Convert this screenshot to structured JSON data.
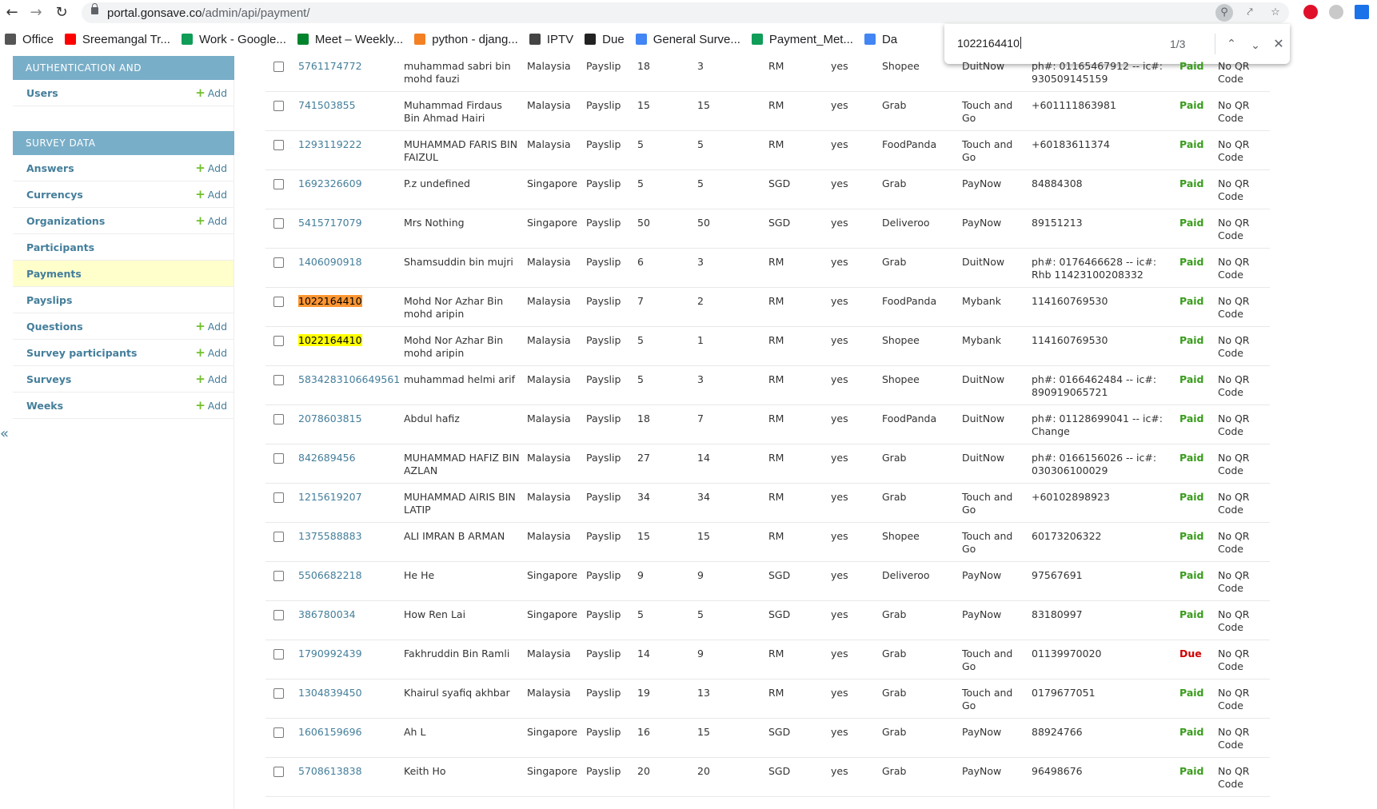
{
  "browser": {
    "url_host": "portal.gonsave.co",
    "url_path": "/admin/api/payment/",
    "bookmarks": [
      {
        "label": "Office",
        "color": "#555555"
      },
      {
        "label": "Sreemangal Tr...",
        "color": "#ff0000"
      },
      {
        "label": "Work - Google...",
        "color": "#0f9d58"
      },
      {
        "label": "Meet – Weekly...",
        "color": "#00832d"
      },
      {
        "label": "python - djang...",
        "color": "#f48024"
      },
      {
        "label": "IPTV",
        "color": "#444444"
      },
      {
        "label": "Due",
        "color": "#222222"
      },
      {
        "label": "General Surve...",
        "color": "#4285f4"
      },
      {
        "label": "Payment_Met...",
        "color": "#0f9d58"
      },
      {
        "label": "Da",
        "color": "#4285f4"
      }
    ]
  },
  "find": {
    "query": "1022164410",
    "count": "1/3"
  },
  "sidebar": {
    "auth": {
      "caption": "AUTHENTICATION AND AUTHORIZATION",
      "items": [
        {
          "label": "Users",
          "add": "Add"
        }
      ]
    },
    "survey": {
      "caption": "SURVEY DATA",
      "items": [
        {
          "label": "Answers",
          "add": "Add"
        },
        {
          "label": "Currencys",
          "add": "Add"
        },
        {
          "label": "Organizations",
          "add": "Add"
        },
        {
          "label": "Participants",
          "add": ""
        },
        {
          "label": "Payments",
          "add": ""
        },
        {
          "label": "Payslips",
          "add": ""
        },
        {
          "label": "Questions",
          "add": "Add"
        },
        {
          "label": "Survey participants",
          "add": "Add"
        },
        {
          "label": "Surveys",
          "add": "Add"
        },
        {
          "label": "Weeks",
          "add": "Add"
        }
      ]
    },
    "collapse_label": "«"
  },
  "rows": [
    {
      "id": "5761174772",
      "name": "muhammad sabri bin mohd fauzi",
      "country": "Malaysia",
      "source": "Payslip",
      "a": "18",
      "b": "3",
      "currency": "RM",
      "confirmed": "yes",
      "platform": "Shopee",
      "method": "DuitNow",
      "account": "ph#: 01165467912 -- ic#: 930509145159",
      "status": "Paid",
      "qr": "No QR Code",
      "highlight": ""
    },
    {
      "id": "741503855",
      "name": "Muhammad Firdaus Bin Ahmad Hairi",
      "country": "Malaysia",
      "source": "Payslip",
      "a": "15",
      "b": "15",
      "currency": "RM",
      "confirmed": "yes",
      "platform": "Grab",
      "method": "Touch and Go",
      "account": "+601111863981",
      "status": "Paid",
      "qr": "No QR Code",
      "highlight": ""
    },
    {
      "id": "1293119222",
      "name": "MUHAMMAD FARIS BIN FAIZUL",
      "country": "Malaysia",
      "source": "Payslip",
      "a": "5",
      "b": "5",
      "currency": "RM",
      "confirmed": "yes",
      "platform": "FoodPanda",
      "method": "Touch and Go",
      "account": "+60183611374",
      "status": "Paid",
      "qr": "No QR Code",
      "highlight": ""
    },
    {
      "id": "1692326609",
      "name": "P.z undefined",
      "country": "Singapore",
      "source": "Payslip",
      "a": "5",
      "b": "5",
      "currency": "SGD",
      "confirmed": "yes",
      "platform": "Grab",
      "method": "PayNow",
      "account": "84884308",
      "status": "Paid",
      "qr": "No QR Code",
      "highlight": ""
    },
    {
      "id": "5415717079",
      "name": "Mrs Nothing",
      "country": "Singapore",
      "source": "Payslip",
      "a": "50",
      "b": "50",
      "currency": "SGD",
      "confirmed": "yes",
      "platform": "Deliveroo",
      "method": "PayNow",
      "account": "89151213",
      "status": "Paid",
      "qr": "No QR Code",
      "highlight": ""
    },
    {
      "id": "1406090918",
      "name": "Shamsuddin bin mujri",
      "country": "Malaysia",
      "source": "Payslip",
      "a": "6",
      "b": "3",
      "currency": "RM",
      "confirmed": "yes",
      "platform": "Grab",
      "method": "DuitNow",
      "account": "ph#: 0176466628 -- ic#: Rhb 11423100208332",
      "status": "Paid",
      "qr": "No QR Code",
      "highlight": ""
    },
    {
      "id": "1022164410",
      "name": "Mohd Nor Azhar Bin mohd aripin",
      "country": "Malaysia",
      "source": "Payslip",
      "a": "7",
      "b": "2",
      "currency": "RM",
      "confirmed": "yes",
      "platform": "FoodPanda",
      "method": "Mybank",
      "account": "114160769530",
      "status": "Paid",
      "qr": "No QR Code",
      "highlight": "current"
    },
    {
      "id": "1022164410",
      "name": "Mohd Nor Azhar Bin mohd aripin",
      "country": "Malaysia",
      "source": "Payslip",
      "a": "5",
      "b": "1",
      "currency": "RM",
      "confirmed": "yes",
      "platform": "Shopee",
      "method": "Mybank",
      "account": "114160769530",
      "status": "Paid",
      "qr": "No QR Code",
      "highlight": "match"
    },
    {
      "id": "5834283106649561",
      "name": "muhammad helmi arif",
      "country": "Malaysia",
      "source": "Payslip",
      "a": "5",
      "b": "3",
      "currency": "RM",
      "confirmed": "yes",
      "platform": "Shopee",
      "method": "DuitNow",
      "account": "ph#: 0166462484 -- ic#: 890919065721",
      "status": "Paid",
      "qr": "No QR Code",
      "highlight": ""
    },
    {
      "id": "2078603815",
      "name": "Abdul hafiz",
      "country": "Malaysia",
      "source": "Payslip",
      "a": "18",
      "b": "7",
      "currency": "RM",
      "confirmed": "yes",
      "platform": "FoodPanda",
      "method": "DuitNow",
      "account": "ph#: 01128699041 -- ic#: Change",
      "status": "Paid",
      "qr": "No QR Code",
      "highlight": ""
    },
    {
      "id": "842689456",
      "name": "MUHAMMAD HAFIZ BIN AZLAN",
      "country": "Malaysia",
      "source": "Payslip",
      "a": "27",
      "b": "14",
      "currency": "RM",
      "confirmed": "yes",
      "platform": "Grab",
      "method": "DuitNow",
      "account": "ph#: 0166156026 -- ic#: 030306100029",
      "status": "Paid",
      "qr": "No QR Code",
      "highlight": ""
    },
    {
      "id": "1215619207",
      "name": "MUHAMMAD AIRIS BIN LATIP",
      "country": "Malaysia",
      "source": "Payslip",
      "a": "34",
      "b": "34",
      "currency": "RM",
      "confirmed": "yes",
      "platform": "Grab",
      "method": "Touch and Go",
      "account": "+60102898923",
      "status": "Paid",
      "qr": "No QR Code",
      "highlight": ""
    },
    {
      "id": "1375588883",
      "name": "ALI IMRAN B ARMAN",
      "country": "Malaysia",
      "source": "Payslip",
      "a": "15",
      "b": "15",
      "currency": "RM",
      "confirmed": "yes",
      "platform": "Shopee",
      "method": "Touch and Go",
      "account": "60173206322",
      "status": "Paid",
      "qr": "No QR Code",
      "highlight": ""
    },
    {
      "id": "5506682218",
      "name": "He He",
      "country": "Singapore",
      "source": "Payslip",
      "a": "9",
      "b": "9",
      "currency": "SGD",
      "confirmed": "yes",
      "platform": "Deliveroo",
      "method": "PayNow",
      "account": "97567691",
      "status": "Paid",
      "qr": "No QR Code",
      "highlight": ""
    },
    {
      "id": "386780034",
      "name": "How Ren Lai",
      "country": "Singapore",
      "source": "Payslip",
      "a": "5",
      "b": "5",
      "currency": "SGD",
      "confirmed": "yes",
      "platform": "Grab",
      "method": "PayNow",
      "account": "83180997",
      "status": "Paid",
      "qr": "No QR Code",
      "highlight": ""
    },
    {
      "id": "1790992439",
      "name": "Fakhruddin Bin Ramli",
      "country": "Malaysia",
      "source": "Payslip",
      "a": "14",
      "b": "9",
      "currency": "RM",
      "confirmed": "yes",
      "platform": "Grab",
      "method": "Touch and Go",
      "account": "01139970020",
      "status": "Due",
      "qr": "No QR Code",
      "highlight": ""
    },
    {
      "id": "1304839450",
      "name": "Khairul syafiq akhbar",
      "country": "Malaysia",
      "source": "Payslip",
      "a": "19",
      "b": "13",
      "currency": "RM",
      "confirmed": "yes",
      "platform": "Grab",
      "method": "Touch and Go",
      "account": "0179677051",
      "status": "Paid",
      "qr": "No QR Code",
      "highlight": ""
    },
    {
      "id": "1606159696",
      "name": "Ah L",
      "country": "Singapore",
      "source": "Payslip",
      "a": "16",
      "b": "15",
      "currency": "SGD",
      "confirmed": "yes",
      "platform": "Grab",
      "method": "PayNow",
      "account": "88924766",
      "status": "Paid",
      "qr": "No QR Code",
      "highlight": ""
    },
    {
      "id": "5708613838",
      "name": "Keith Ho",
      "country": "Singapore",
      "source": "Payslip",
      "a": "20",
      "b": "20",
      "currency": "SGD",
      "confirmed": "yes",
      "platform": "Grab",
      "method": "PayNow",
      "account": "96498676",
      "status": "Paid",
      "qr": "No QR Code",
      "highlight": ""
    }
  ],
  "colors": {
    "module_caption_bg": "#79aec8",
    "link": "#447e9b",
    "add_plus": "#70bf2b",
    "current_row_bg": "#ffffcc",
    "status_paid": "#3a9c1d",
    "status_due": "#d10000",
    "find_current_highlight": "#ff9632",
    "find_match_highlight": "#ffff00"
  },
  "icons": {
    "back": "arrow-left-icon",
    "forward": "arrow-right-icon",
    "reload": "reload-icon",
    "find_prev": "chevron-up-icon",
    "find_next": "chevron-down-icon",
    "find_close": "close-icon",
    "bookmark_star": "star-icon",
    "share": "share-icon"
  }
}
